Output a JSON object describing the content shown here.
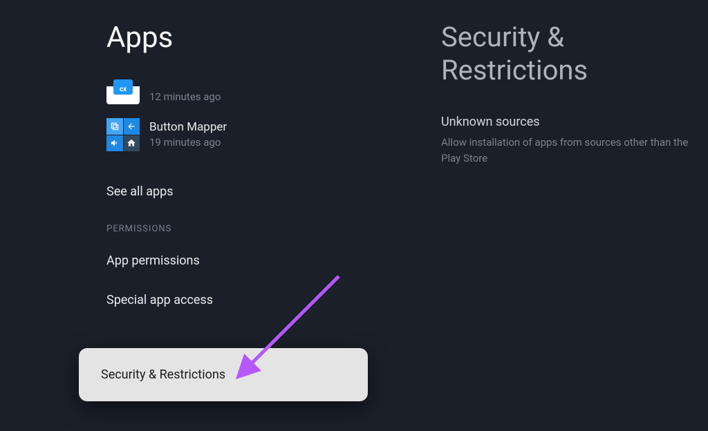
{
  "left": {
    "title": "Apps",
    "recent": [
      {
        "name": "",
        "time": "12 minutes ago",
        "icon": "cx"
      },
      {
        "name": "Button Mapper",
        "time": "19 minutes ago",
        "icon": "button-mapper"
      }
    ],
    "see_all": "See all apps",
    "sections": {
      "permissions_header": "PERMISSIONS",
      "items": [
        "App permissions",
        "Special app access",
        "Security & Restrictions"
      ]
    }
  },
  "right": {
    "title": "Security & Restrictions",
    "option": {
      "title": "Unknown sources",
      "desc": "Allow installation of apps from sources other than the Play Store"
    }
  }
}
